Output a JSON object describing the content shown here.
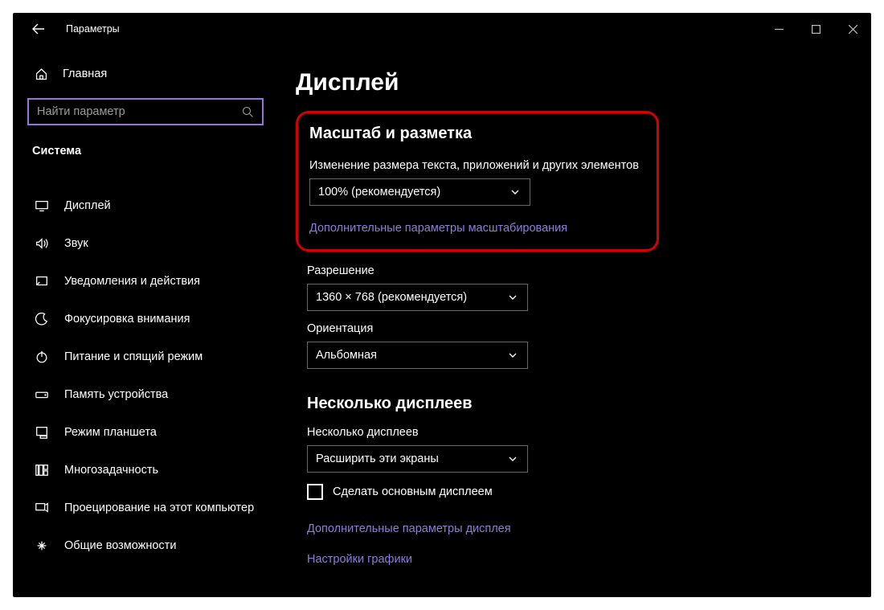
{
  "window": {
    "title": "Параметры"
  },
  "sidebar": {
    "home": "Главная",
    "search_placeholder": "Найти параметр",
    "section": "Система",
    "items": [
      {
        "label": "Дисплей"
      },
      {
        "label": "Звук"
      },
      {
        "label": "Уведомления и действия"
      },
      {
        "label": "Фокусировка внимания"
      },
      {
        "label": "Питание и спящий режим"
      },
      {
        "label": "Память устройства"
      },
      {
        "label": "Режим планшета"
      },
      {
        "label": "Многозадачность"
      },
      {
        "label": "Проецирование на этот компьютер"
      },
      {
        "label": "Общие возможности"
      }
    ]
  },
  "main": {
    "title": "Дисплей",
    "scale": {
      "heading": "Масштаб и разметка",
      "label": "Изменение размера текста, приложений и других элементов",
      "value": "100% (рекомендуется)",
      "link": "Дополнительные параметры масштабирования"
    },
    "resolution": {
      "label": "Разрешение",
      "value": "1360 × 768 (рекомендуется)"
    },
    "orientation": {
      "label": "Ориентация",
      "value": "Альбомная"
    },
    "multi": {
      "heading": "Несколько дисплеев",
      "label": "Несколько дисплеев",
      "value": "Расширить эти экраны",
      "checkbox_label": "Сделать основным дисплеем",
      "link1": "Дополнительные параметры дисплея",
      "link2": "Настройки графики"
    }
  }
}
